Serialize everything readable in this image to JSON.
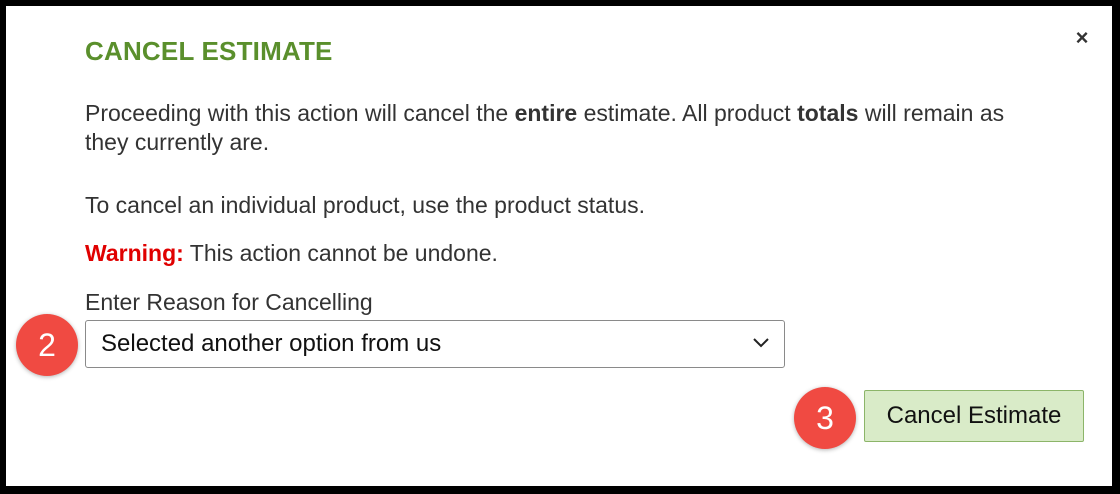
{
  "dialog": {
    "title": "CANCEL ESTIMATE",
    "close_icon": "×",
    "paragraph1": {
      "t1": "Proceeding with this action will cancel the ",
      "b1": "entire",
      "t2": " estimate. All product ",
      "b2": "totals",
      "t3": " will remain as they currently are."
    },
    "paragraph2": "To cancel an individual product, use the product status.",
    "warning": {
      "label": "Warning:",
      "text": " This action cannot be undone."
    },
    "reason_label": "Enter Reason for Cancelling",
    "reason_selected": "Selected another option from us",
    "submit_label": "Cancel Estimate"
  },
  "annotations": {
    "step2": "2",
    "step3": "3"
  },
  "colors": {
    "title": "#5a8f2c",
    "warning": "#e00000",
    "badge": "#f04a42",
    "button_bg": "#d9ebc8"
  },
  "icons": {
    "close": "close-icon",
    "dropdown": "chevron-down-icon"
  }
}
